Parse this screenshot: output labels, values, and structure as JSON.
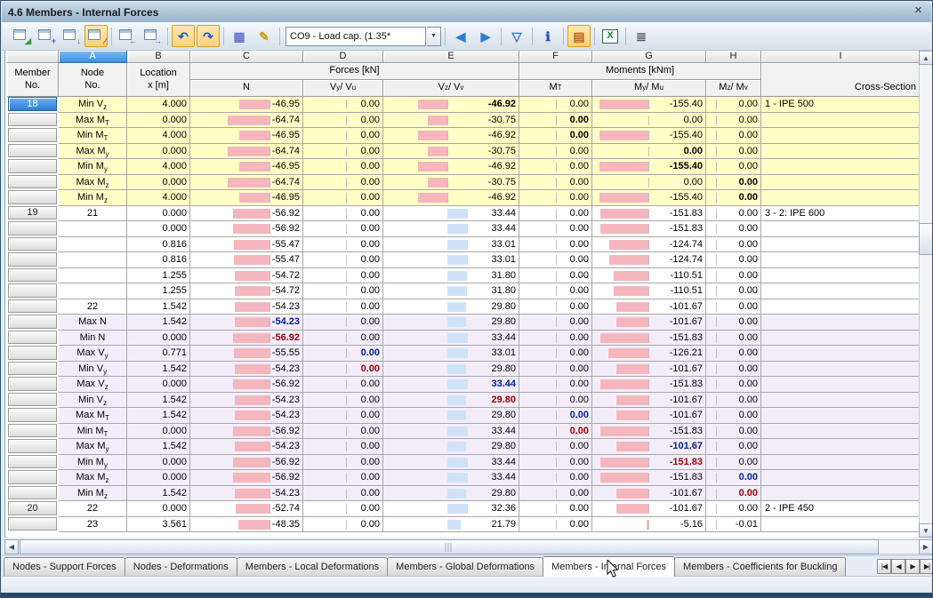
{
  "window": {
    "title": "4.6 Members - Internal Forces",
    "close_glyph": "✕"
  },
  "toolbar": {
    "combo_value": "CO9 - Load cap. (1.35*",
    "items": [
      {
        "type": "btn",
        "name": "results-check-icon",
        "style": "chip",
        "glyph": "◢",
        "color": "#2e9e3a"
      },
      {
        "type": "btn",
        "name": "table-add-row-icon",
        "style": "chip",
        "glyph": "+",
        "color": "#2b5fd0"
      },
      {
        "type": "btn",
        "name": "table-jump-down-icon",
        "style": "chip",
        "glyph": "↓",
        "color": "#2b5fd0"
      },
      {
        "type": "btn",
        "name": "result-diagram-icon",
        "style": "chip",
        "glyph": "∕",
        "color": "#d02b2b",
        "pressed": true
      },
      {
        "type": "sep"
      },
      {
        "type": "btn",
        "name": "previous-table-icon",
        "style": "chip",
        "glyph": "←",
        "color": "#2b5fd0"
      },
      {
        "type": "btn",
        "name": "next-table-icon",
        "style": "chip",
        "glyph": "→",
        "color": "#2b5fd0"
      },
      {
        "type": "sep"
      },
      {
        "type": "btn",
        "name": "undo-icon",
        "style": "plain",
        "glyph": "↶",
        "color": "#2255cc",
        "pressed": true
      },
      {
        "type": "btn",
        "name": "redo-icon",
        "style": "plain",
        "glyph": "↷",
        "color": "#2255cc",
        "pressed": true
      },
      {
        "type": "sep"
      },
      {
        "type": "btn",
        "name": "table-grid-icon",
        "style": "plain",
        "glyph": "▦",
        "color": "#6677cc"
      },
      {
        "type": "btn",
        "name": "edit-pencil-icon",
        "style": "plain",
        "glyph": "✎",
        "color": "#c9a10a"
      },
      {
        "type": "sep"
      },
      {
        "type": "combo"
      },
      {
        "type": "sep"
      },
      {
        "type": "btn",
        "name": "previous-member-icon",
        "style": "plain",
        "glyph": "◀",
        "color": "#2d7dd2"
      },
      {
        "type": "btn",
        "name": "next-member-icon",
        "style": "plain",
        "glyph": "▶",
        "color": "#2d7dd2"
      },
      {
        "type": "sep"
      },
      {
        "type": "btn",
        "name": "filter-icon",
        "style": "plain",
        "glyph": "▽",
        "color": "#3a6fd8"
      },
      {
        "type": "sep"
      },
      {
        "type": "btn",
        "name": "info-icon",
        "style": "plain",
        "glyph": "ℹ",
        "color": "#1a4fc4"
      },
      {
        "type": "sep"
      },
      {
        "type": "btn",
        "name": "diagram-bars-icon",
        "style": "plain",
        "glyph": "▤",
        "color": "#b5651d",
        "pressed": true
      },
      {
        "type": "sep"
      },
      {
        "type": "btn",
        "name": "excel-export-icon",
        "style": "excel",
        "glyph": "X",
        "color": "#1f7244"
      },
      {
        "type": "sep"
      },
      {
        "type": "btn",
        "name": "calculator-icon",
        "style": "plain",
        "glyph": "≣",
        "color": "#555555"
      }
    ]
  },
  "table": {
    "column_letters": [
      "A",
      "B",
      "C",
      "D",
      "E",
      "F",
      "G",
      "H",
      "I"
    ],
    "selected_letter": "A",
    "headers": {
      "member": "Member|No.",
      "node": "Node|No.",
      "location": "Location|x [m]",
      "forces_group": "Forces [kN]",
      "moments_group": "Moments [kNm]",
      "n": "N",
      "vy": "V~y~ / V~u~",
      "vz": "V~z~ / V~v~",
      "mt": "M~T~",
      "my": "M~y~ / M~u~",
      "mz": "M~z~ / M~v~",
      "cross_section": "Cross-Section"
    },
    "bar_colors": {
      "negative": "#f5b6be",
      "positive": "#cfe2f8"
    },
    "rows": [
      {
        "member": "18",
        "sel": true,
        "label": "Min V~z~",
        "x": "4.000",
        "n": "-46.95",
        "vy": "0.00",
        "vz": "-46.92",
        "mt": "0.00",
        "my": "-155.40",
        "mz": "0.00",
        "cs": "1 - IPE 500",
        "bg": "y",
        "bold": "vz",
        "bc": "bk"
      },
      {
        "member": "",
        "label": "Max M~T~",
        "x": "0.000",
        "n": "-64.74",
        "vy": "0.00",
        "vz": "-30.75",
        "mt": "0.00",
        "my": "0.00",
        "mz": "0.00",
        "cs": "",
        "bg": "y",
        "bold": "mt",
        "bc": "bk"
      },
      {
        "member": "",
        "label": "Min M~T~",
        "x": "4.000",
        "n": "-46.95",
        "vy": "0.00",
        "vz": "-46.92",
        "mt": "0.00",
        "my": "-155.40",
        "mz": "0.00",
        "cs": "",
        "bg": "y",
        "bold": "mt",
        "bc": "bk"
      },
      {
        "member": "",
        "label": "Max M~y~",
        "x": "0.000",
        "n": "-64.74",
        "vy": "0.00",
        "vz": "-30.75",
        "mt": "0.00",
        "my": "0.00",
        "mz": "0.00",
        "cs": "",
        "bg": "y",
        "bold": "my",
        "bc": "bk"
      },
      {
        "member": "",
        "label": "Min M~y~",
        "x": "4.000",
        "n": "-46.95",
        "vy": "0.00",
        "vz": "-46.92",
        "mt": "0.00",
        "my": "-155.40",
        "mz": "0.00",
        "cs": "",
        "bg": "y",
        "bold": "my",
        "bc": "bk"
      },
      {
        "member": "",
        "label": "Max M~z~",
        "x": "0.000",
        "n": "-64.74",
        "vy": "0.00",
        "vz": "-30.75",
        "mt": "0.00",
        "my": "0.00",
        "mz": "0.00",
        "cs": "",
        "bg": "y",
        "bold": "mz",
        "bc": "bk"
      },
      {
        "member": "",
        "label": "Min M~z~",
        "x": "4.000",
        "n": "-46.95",
        "vy": "0.00",
        "vz": "-46.92",
        "mt": "0.00",
        "my": "-155.40",
        "mz": "0.00",
        "cs": "",
        "bg": "y",
        "bold": "mz",
        "bc": "bk"
      },
      {
        "member": "19",
        "label": "21",
        "x": "0.000",
        "n": "-56.92",
        "vy": "0.00",
        "vz": "33.44",
        "mt": "0.00",
        "my": "-151.83",
        "mz": "0.00",
        "cs": "3 - 2: IPE 600",
        "bg": "w"
      },
      {
        "member": "",
        "label": "",
        "x": "0.000",
        "n": "-56.92",
        "vy": "0.00",
        "vz": "33.44",
        "mt": "0.00",
        "my": "-151.83",
        "mz": "0.00",
        "cs": "",
        "bg": "w"
      },
      {
        "member": "",
        "label": "",
        "x": "0.816",
        "n": "-55.47",
        "vy": "0.00",
        "vz": "33.01",
        "mt": "0.00",
        "my": "-124.74",
        "mz": "0.00",
        "cs": "",
        "bg": "w"
      },
      {
        "member": "",
        "label": "",
        "x": "0.816",
        "n": "-55.47",
        "vy": "0.00",
        "vz": "33.01",
        "mt": "0.00",
        "my": "-124.74",
        "mz": "0.00",
        "cs": "",
        "bg": "w"
      },
      {
        "member": "",
        "label": "",
        "x": "1.255",
        "n": "-54.72",
        "vy": "0.00",
        "vz": "31.80",
        "mt": "0.00",
        "my": "-110.51",
        "mz": "0.00",
        "cs": "",
        "bg": "w"
      },
      {
        "member": "",
        "label": "",
        "x": "1.255",
        "n": "-54.72",
        "vy": "0.00",
        "vz": "31.80",
        "mt": "0.00",
        "my": "-110.51",
        "mz": "0.00",
        "cs": "",
        "bg": "w"
      },
      {
        "member": "",
        "label": "22",
        "x": "1.542",
        "n": "-54.23",
        "vy": "0.00",
        "vz": "29.80",
        "mt": "0.00",
        "my": "-101.67",
        "mz": "0.00",
        "cs": "",
        "bg": "w"
      },
      {
        "member": "",
        "label": "Max N",
        "x": "1.542",
        "n": "-54.23",
        "vy": "0.00",
        "vz": "29.80",
        "mt": "0.00",
        "my": "-101.67",
        "mz": "0.00",
        "cs": "",
        "bg": "l",
        "bold": "n",
        "bc": "bmax"
      },
      {
        "member": "",
        "label": "Min N",
        "x": "0.000",
        "n": "-56.92",
        "vy": "0.00",
        "vz": "33.44",
        "mt": "0.00",
        "my": "-151.83",
        "mz": "0.00",
        "cs": "",
        "bg": "l",
        "bold": "n",
        "bc": "bmin"
      },
      {
        "member": "",
        "label": "Max V~y~",
        "x": "0.771",
        "n": "-55.55",
        "vy": "0.00",
        "vz": "33.01",
        "mt": "0.00",
        "my": "-126.21",
        "mz": "0.00",
        "cs": "",
        "bg": "l",
        "bold": "vy",
        "bc": "bmax"
      },
      {
        "member": "",
        "label": "Min V~y~",
        "x": "1.542",
        "n": "-54.23",
        "vy": "0.00",
        "vz": "29.80",
        "mt": "0.00",
        "my": "-101.67",
        "mz": "0.00",
        "cs": "",
        "bg": "l",
        "bold": "vy",
        "bc": "bmin"
      },
      {
        "member": "",
        "label": "Max V~z~",
        "x": "0.000",
        "n": "-56.92",
        "vy": "0.00",
        "vz": "33.44",
        "mt": "0.00",
        "my": "-151.83",
        "mz": "0.00",
        "cs": "",
        "bg": "l",
        "bold": "vz",
        "bc": "bmax"
      },
      {
        "member": "",
        "label": "Min V~z~",
        "x": "1.542",
        "n": "-54.23",
        "vy": "0.00",
        "vz": "29.80",
        "mt": "0.00",
        "my": "-101.67",
        "mz": "0.00",
        "cs": "",
        "bg": "l",
        "bold": "vz",
        "bc": "bmin"
      },
      {
        "member": "",
        "label": "Max M~T~",
        "x": "1.542",
        "n": "-54.23",
        "vy": "0.00",
        "vz": "29.80",
        "mt": "0.00",
        "my": "-101.67",
        "mz": "0.00",
        "cs": "",
        "bg": "l",
        "bold": "mt",
        "bc": "bmax"
      },
      {
        "member": "",
        "label": "Min M~T~",
        "x": "0.000",
        "n": "-56.92",
        "vy": "0.00",
        "vz": "33.44",
        "mt": "0.00",
        "my": "-151.83",
        "mz": "0.00",
        "cs": "",
        "bg": "l",
        "bold": "mt",
        "bc": "bmin"
      },
      {
        "member": "",
        "label": "Max M~y~",
        "x": "1.542",
        "n": "-54.23",
        "vy": "0.00",
        "vz": "29.80",
        "mt": "0.00",
        "my": "-101.67",
        "mz": "0.00",
        "cs": "",
        "bg": "l",
        "bold": "my",
        "bc": "bmax"
      },
      {
        "member": "",
        "label": "Min M~y~",
        "x": "0.000",
        "n": "-56.92",
        "vy": "0.00",
        "vz": "33.44",
        "mt": "0.00",
        "my": "-151.83",
        "mz": "0.00",
        "cs": "",
        "bg": "l",
        "bold": "my",
        "bc": "bmin"
      },
      {
        "member": "",
        "label": "Max M~z~",
        "x": "0.000",
        "n": "-56.92",
        "vy": "0.00",
        "vz": "33.44",
        "mt": "0.00",
        "my": "-151.83",
        "mz": "0.00",
        "cs": "",
        "bg": "l",
        "bold": "mz",
        "bc": "bmax"
      },
      {
        "member": "",
        "label": "Min M~z~",
        "x": "1.542",
        "n": "-54.23",
        "vy": "0.00",
        "vz": "29.80",
        "mt": "0.00",
        "my": "-101.67",
        "mz": "0.00",
        "cs": "",
        "bg": "l",
        "bold": "mz",
        "bc": "bmin"
      },
      {
        "member": "20",
        "label": "22",
        "x": "0.000",
        "n": "-52.74",
        "vy": "0.00",
        "vz": "32.36",
        "mt": "0.00",
        "my": "-101.67",
        "mz": "0.00",
        "cs": "2 - IPE 450",
        "bg": "w"
      },
      {
        "member": "",
        "label": "23",
        "x": "3.561",
        "n": "-48.35",
        "vy": "0.00",
        "vz": "21.79",
        "mt": "0.00",
        "my": "-5.16",
        "mz": "-0.01",
        "cs": "",
        "bg": "w"
      }
    ]
  },
  "tabs": {
    "items": [
      {
        "label": "Nodes - Support Forces",
        "active": false
      },
      {
        "label": "Nodes - Deformations",
        "active": false
      },
      {
        "label": "Members - Local Deformations",
        "active": false
      },
      {
        "label": "Members - Global Deformations",
        "active": false
      },
      {
        "label": "Members - Internal Forces",
        "active": true
      },
      {
        "label": "Members - Coefficients for Buckling",
        "active": false
      }
    ],
    "nav": [
      {
        "name": "first-tab-button",
        "glyph": "|◀"
      },
      {
        "name": "previous-tab-button",
        "glyph": "◀"
      },
      {
        "name": "next-tab-button",
        "glyph": "▶"
      },
      {
        "name": "last-tab-button",
        "glyph": "▶|"
      }
    ]
  },
  "scrollbars": {
    "up": "▲",
    "down": "▼",
    "left": "◀",
    "right": "▶"
  }
}
